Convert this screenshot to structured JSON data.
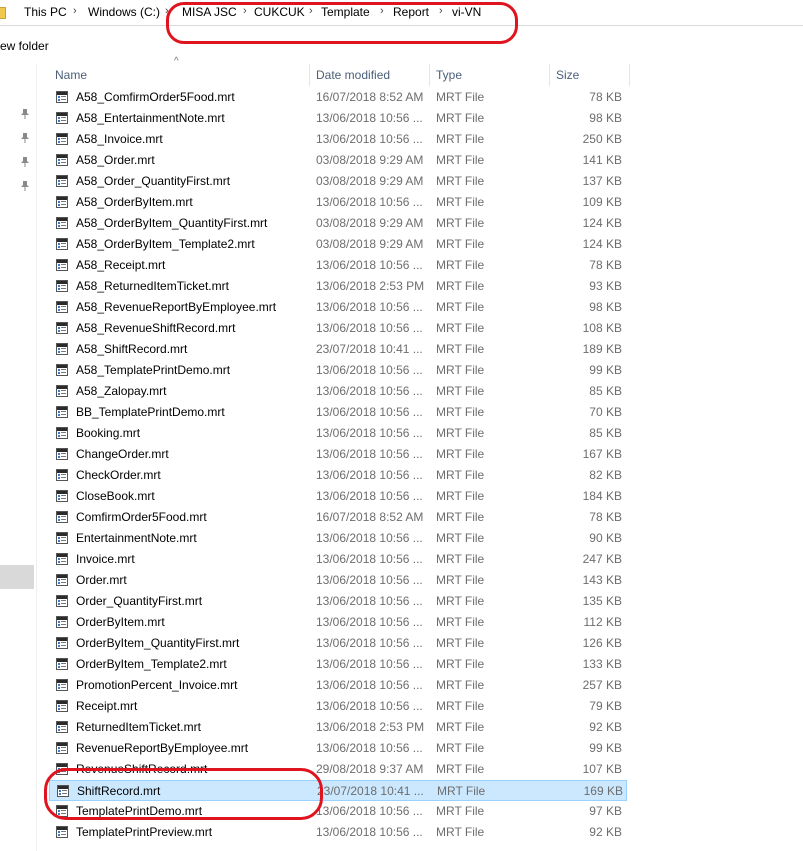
{
  "breadcrumb": {
    "items": [
      "This PC",
      "Windows (C:)",
      "MISA JSC",
      "CUKCUK",
      "Template",
      "Report",
      "vi-VN"
    ]
  },
  "toolbar": {
    "new_folder_label": "ew folder"
  },
  "columns": {
    "name": "Name",
    "date": "Date modified",
    "type": "Type",
    "size": "Size"
  },
  "files": [
    {
      "name": "A58_ComfirmOrder5Food.mrt",
      "date": "16/07/2018 8:52 AM",
      "type": "MRT File",
      "size": "78 KB"
    },
    {
      "name": "A58_EntertainmentNote.mrt",
      "date": "13/06/2018 10:56 ...",
      "type": "MRT File",
      "size": "98 KB"
    },
    {
      "name": "A58_Invoice.mrt",
      "date": "13/06/2018 10:56 ...",
      "type": "MRT File",
      "size": "250 KB"
    },
    {
      "name": "A58_Order.mrt",
      "date": "03/08/2018 9:29 AM",
      "type": "MRT File",
      "size": "141 KB"
    },
    {
      "name": "A58_Order_QuantityFirst.mrt",
      "date": "03/08/2018 9:29 AM",
      "type": "MRT File",
      "size": "137 KB"
    },
    {
      "name": "A58_OrderByItem.mrt",
      "date": "13/06/2018 10:56 ...",
      "type": "MRT File",
      "size": "109 KB"
    },
    {
      "name": "A58_OrderByItem_QuantityFirst.mrt",
      "date": "03/08/2018 9:29 AM",
      "type": "MRT File",
      "size": "124 KB"
    },
    {
      "name": "A58_OrderByItem_Template2.mrt",
      "date": "03/08/2018 9:29 AM",
      "type": "MRT File",
      "size": "124 KB"
    },
    {
      "name": "A58_Receipt.mrt",
      "date": "13/06/2018 10:56 ...",
      "type": "MRT File",
      "size": "78 KB"
    },
    {
      "name": "A58_ReturnedItemTicket.mrt",
      "date": "13/06/2018 2:53 PM",
      "type": "MRT File",
      "size": "93 KB"
    },
    {
      "name": "A58_RevenueReportByEmployee.mrt",
      "date": "13/06/2018 10:56 ...",
      "type": "MRT File",
      "size": "98 KB"
    },
    {
      "name": "A58_RevenueShiftRecord.mrt",
      "date": "13/06/2018 10:56 ...",
      "type": "MRT File",
      "size": "108 KB"
    },
    {
      "name": "A58_ShiftRecord.mrt",
      "date": "23/07/2018 10:41 ...",
      "type": "MRT File",
      "size": "189 KB"
    },
    {
      "name": "A58_TemplatePrintDemo.mrt",
      "date": "13/06/2018 10:56 ...",
      "type": "MRT File",
      "size": "99 KB"
    },
    {
      "name": "A58_Zalopay.mrt",
      "date": "13/06/2018 10:56 ...",
      "type": "MRT File",
      "size": "85 KB"
    },
    {
      "name": "BB_TemplatePrintDemo.mrt",
      "date": "13/06/2018 10:56 ...",
      "type": "MRT File",
      "size": "70 KB"
    },
    {
      "name": "Booking.mrt",
      "date": "13/06/2018 10:56 ...",
      "type": "MRT File",
      "size": "85 KB"
    },
    {
      "name": "ChangeOrder.mrt",
      "date": "13/06/2018 10:56 ...",
      "type": "MRT File",
      "size": "167 KB"
    },
    {
      "name": "CheckOrder.mrt",
      "date": "13/06/2018 10:56 ...",
      "type": "MRT File",
      "size": "82 KB"
    },
    {
      "name": "CloseBook.mrt",
      "date": "13/06/2018 10:56 ...",
      "type": "MRT File",
      "size": "184 KB"
    },
    {
      "name": "ComfirmOrder5Food.mrt",
      "date": "16/07/2018 8:52 AM",
      "type": "MRT File",
      "size": "78 KB"
    },
    {
      "name": "EntertainmentNote.mrt",
      "date": "13/06/2018 10:56 ...",
      "type": "MRT File",
      "size": "90 KB"
    },
    {
      "name": "Invoice.mrt",
      "date": "13/06/2018 10:56 ...",
      "type": "MRT File",
      "size": "247 KB"
    },
    {
      "name": "Order.mrt",
      "date": "13/06/2018 10:56 ...",
      "type": "MRT File",
      "size": "143 KB"
    },
    {
      "name": "Order_QuantityFirst.mrt",
      "date": "13/06/2018 10:56 ...",
      "type": "MRT File",
      "size": "135 KB"
    },
    {
      "name": "OrderByItem.mrt",
      "date": "13/06/2018 10:56 ...",
      "type": "MRT File",
      "size": "112 KB"
    },
    {
      "name": "OrderByItem_QuantityFirst.mrt",
      "date": "13/06/2018 10:56 ...",
      "type": "MRT File",
      "size": "126 KB"
    },
    {
      "name": "OrderByItem_Template2.mrt",
      "date": "13/06/2018 10:56 ...",
      "type": "MRT File",
      "size": "133 KB"
    },
    {
      "name": "PromotionPercent_Invoice.mrt",
      "date": "13/06/2018 10:56 ...",
      "type": "MRT File",
      "size": "257 KB"
    },
    {
      "name": "Receipt.mrt",
      "date": "13/06/2018 10:56 ...",
      "type": "MRT File",
      "size": "79 KB"
    },
    {
      "name": "ReturnedItemTicket.mrt",
      "date": "13/06/2018 2:53 PM",
      "type": "MRT File",
      "size": "92 KB"
    },
    {
      "name": "RevenueReportByEmployee.mrt",
      "date": "13/06/2018 10:56 ...",
      "type": "MRT File",
      "size": "99 KB"
    },
    {
      "name": "RevenueShiftRecord.mrt",
      "date": "29/08/2018 9:37 AM",
      "type": "MRT File",
      "size": "107 KB"
    },
    {
      "name": "ShiftRecord.mrt",
      "date": "23/07/2018 10:41 ...",
      "type": "MRT File",
      "size": "169 KB",
      "selected": true
    },
    {
      "name": "TemplatePrintDemo.mrt",
      "date": "13/06/2018 10:56 ...",
      "type": "MRT File",
      "size": "97 KB"
    },
    {
      "name": "TemplatePrintPreview.mrt",
      "date": "13/06/2018 10:56 ...",
      "type": "MRT File",
      "size": "92 KB"
    }
  ],
  "colors": {
    "annotation": "#e0141e",
    "selection": "#cce8ff",
    "selection_border": "#99d1ff"
  },
  "icons": {
    "file": "mrt-file-icon",
    "pin": "pin-icon"
  }
}
